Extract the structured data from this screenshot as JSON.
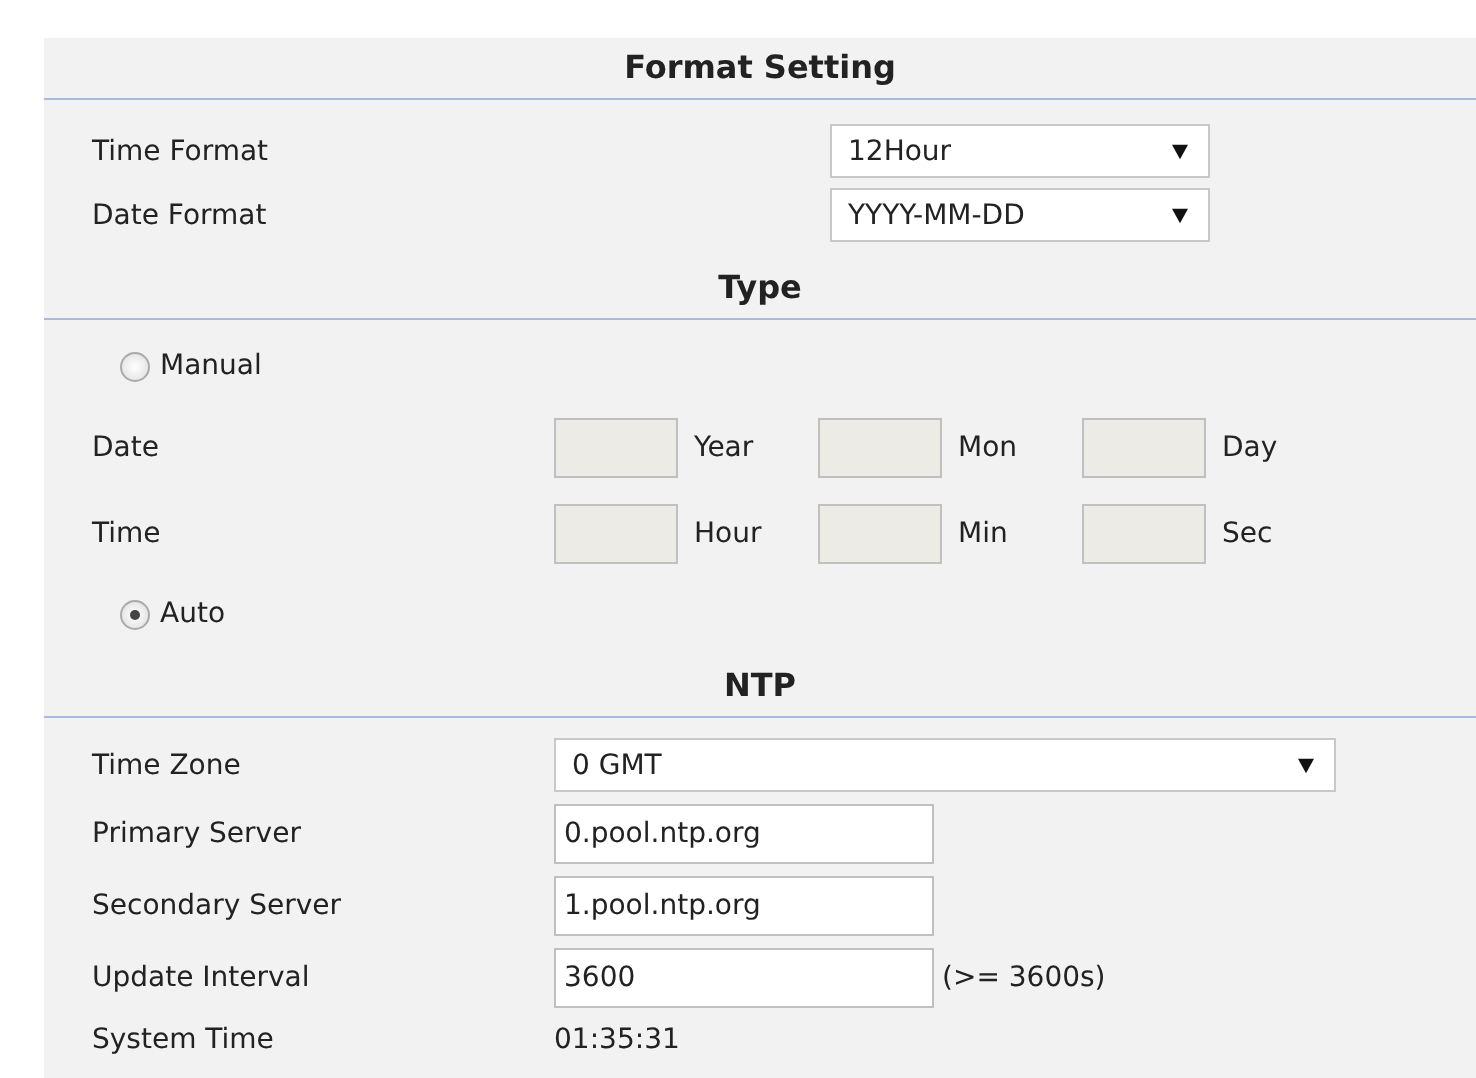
{
  "sections": [
    {
      "kind": "format",
      "title": "Format Setting",
      "rows": [
        {
          "kind": "select",
          "label": "Time Format",
          "value": "12Hour"
        },
        {
          "kind": "select",
          "label": "Date Format",
          "value": "YYYY-MM-DD"
        }
      ]
    },
    {
      "kind": "type",
      "title": "Type",
      "rows": [
        {
          "kind": "radio",
          "label": "Manual",
          "selected": false
        },
        {
          "kind": "triple",
          "label": "Date",
          "units": [
            "Year",
            "Mon",
            "Day"
          ]
        },
        {
          "kind": "triple",
          "label": "Time",
          "units": [
            "Hour",
            "Min",
            "Sec"
          ]
        },
        {
          "kind": "radio",
          "label": "Auto",
          "selected": true
        }
      ]
    },
    {
      "kind": "ntp",
      "title": "NTP",
      "rows": [
        {
          "kind": "wideselect",
          "label": "Time Zone",
          "value": "0 GMT"
        },
        {
          "kind": "input",
          "label": "Primary Server",
          "value": "0.pool.ntp.org"
        },
        {
          "kind": "input",
          "label": "Secondary Server",
          "value": "1.pool.ntp.org"
        },
        {
          "kind": "input",
          "label": "Update Interval",
          "value": "3600",
          "hint": "(>= 3600s)"
        },
        {
          "kind": "text",
          "label": "System Time",
          "value": "01:35:31"
        }
      ]
    }
  ]
}
